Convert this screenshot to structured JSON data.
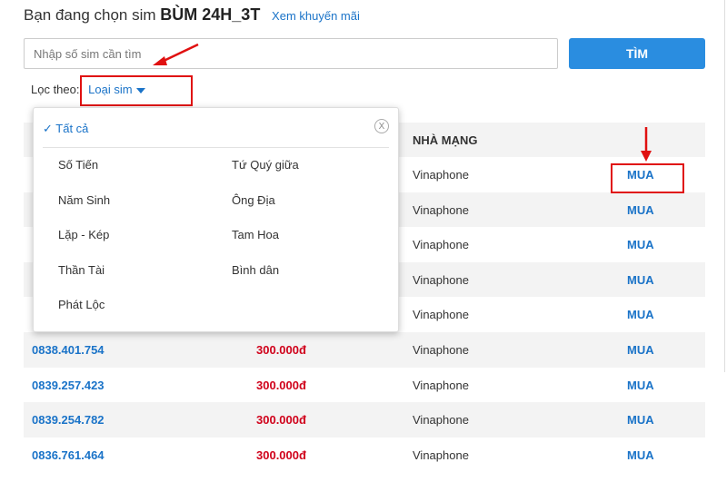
{
  "header": {
    "prefix": "Bạn đang chọn sim",
    "package_name": "BÙM 24H_3T",
    "promo_link": "Xem khuyến mãi"
  },
  "search": {
    "placeholder": "Nhập số sim cần tìm",
    "value": "",
    "button_label": "TÌM"
  },
  "filter": {
    "label": "Lọc theo:",
    "selected": "Loại sim"
  },
  "dropdown": {
    "all_label": "Tất cả",
    "close_label": "X",
    "options": [
      "Số Tiến",
      "Tứ Quý giữa",
      "Năm Sinh",
      "Ông Địa",
      "Lặp - Kép",
      "Tam Hoa",
      "Thần Tài",
      "Bình dân",
      "Phát Lộc"
    ]
  },
  "table": {
    "header_network": "NHÀ MẠNG",
    "rows": [
      {
        "number": "",
        "price": "",
        "network": "Vinaphone",
        "buy": "MUA"
      },
      {
        "number": "",
        "price": "",
        "network": "Vinaphone",
        "buy": "MUA"
      },
      {
        "number": "",
        "price": "",
        "network": "Vinaphone",
        "buy": "MUA"
      },
      {
        "number": "",
        "price": "",
        "network": "Vinaphone",
        "buy": "MUA"
      },
      {
        "number": "",
        "price": "",
        "network": "Vinaphone",
        "buy": "MUA"
      },
      {
        "number": "0838.401.754",
        "price": "300.000đ",
        "network": "Vinaphone",
        "buy": "MUA"
      },
      {
        "number": "0839.257.423",
        "price": "300.000đ",
        "network": "Vinaphone",
        "buy": "MUA"
      },
      {
        "number": "0839.254.782",
        "price": "300.000đ",
        "network": "Vinaphone",
        "buy": "MUA"
      },
      {
        "number": "0836.761.464",
        "price": "300.000đ",
        "network": "Vinaphone",
        "buy": "MUA"
      }
    ]
  },
  "colors": {
    "accent_blue": "#1a73c8",
    "button_blue": "#2a8de0",
    "price_red": "#d0021b",
    "annotation_red": "#e01010"
  }
}
